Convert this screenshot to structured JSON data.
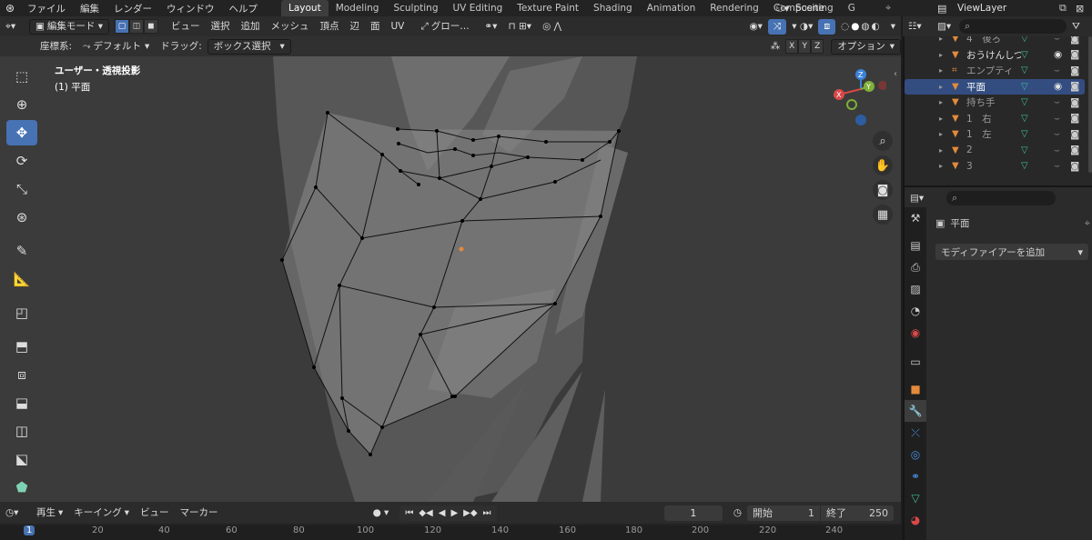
{
  "topbar": {
    "menus": [
      "ファイル",
      "編集",
      "レンダー",
      "ウィンドウ",
      "ヘルプ"
    ],
    "workspace_tabs": [
      {
        "label": "Layout",
        "active": true
      },
      {
        "label": "Modeling",
        "active": false
      },
      {
        "label": "Sculpting",
        "active": false
      },
      {
        "label": "UV Editing",
        "active": false
      },
      {
        "label": "Texture Paint",
        "active": false
      },
      {
        "label": "Shading",
        "active": false
      },
      {
        "label": "Animation",
        "active": false
      },
      {
        "label": "Rendering",
        "active": false
      },
      {
        "label": "Compositing",
        "active": false
      },
      {
        "label": "G",
        "active": false
      }
    ],
    "scene": "Scene",
    "view_layer": "ViewLayer"
  },
  "viewport": {
    "mode": "編集モード",
    "menus": [
      "ビュー",
      "選択",
      "追加",
      "メッシュ",
      "頂点",
      "辺",
      "面",
      "UV"
    ],
    "transform_orientation": "グロー…",
    "coord_label": "座標系:",
    "coord_value": "デフォルト",
    "drag_label": "ドラッグ:",
    "drag_value": "ボックス選択",
    "axes": [
      "X",
      "Y",
      "Z"
    ],
    "options": "オプション",
    "view_name": "ユーザー・透視投影",
    "object_name": "(1) 平面",
    "gizmo": {
      "x": "X",
      "y": "Y",
      "z": "Z"
    }
  },
  "timeline": {
    "playback": "再生",
    "keying": "キーイング",
    "view": "ビュー",
    "marker": "マーカー",
    "current_frame": "1",
    "start_label": "開始",
    "start": "1",
    "end_label": "終了",
    "end": "250",
    "ruler": [
      "1",
      "20",
      "40",
      "60",
      "80",
      "100",
      "120",
      "140",
      "160",
      "180",
      "200",
      "220",
      "240"
    ]
  },
  "outliner": {
    "rows": [
      {
        "label": "4　後ろ",
        "selected": false,
        "type": "mesh",
        "dim": true
      },
      {
        "label": "おうけんしつらい",
        "selected": false,
        "type": "mesh",
        "dim": false
      },
      {
        "label": "エンプティ",
        "selected": false,
        "type": "empty",
        "dim": true
      },
      {
        "label": "平面",
        "selected": true,
        "type": "mesh",
        "dim": false
      },
      {
        "label": "持ち手",
        "selected": false,
        "type": "mesh",
        "dim": true
      },
      {
        "label": "1　右",
        "selected": false,
        "type": "mesh",
        "dim": true
      },
      {
        "label": "1　左",
        "selected": false,
        "type": "mesh",
        "dim": true
      },
      {
        "label": "2",
        "selected": false,
        "type": "mesh",
        "dim": true
      },
      {
        "label": "3",
        "selected": false,
        "type": "mesh",
        "dim": true
      }
    ]
  },
  "properties": {
    "object_name": "平面",
    "add_modifier": "モディファイアーを追加"
  },
  "colors": {
    "accent": "#4772b3",
    "selected_row": "#334d80",
    "mesh_icon": "#e38a3b",
    "modifier_icon": "#3fb99a",
    "gizmo_x": "#d94848",
    "gizmo_y": "#7fb03a",
    "gizmo_z": "#3b82d9"
  }
}
